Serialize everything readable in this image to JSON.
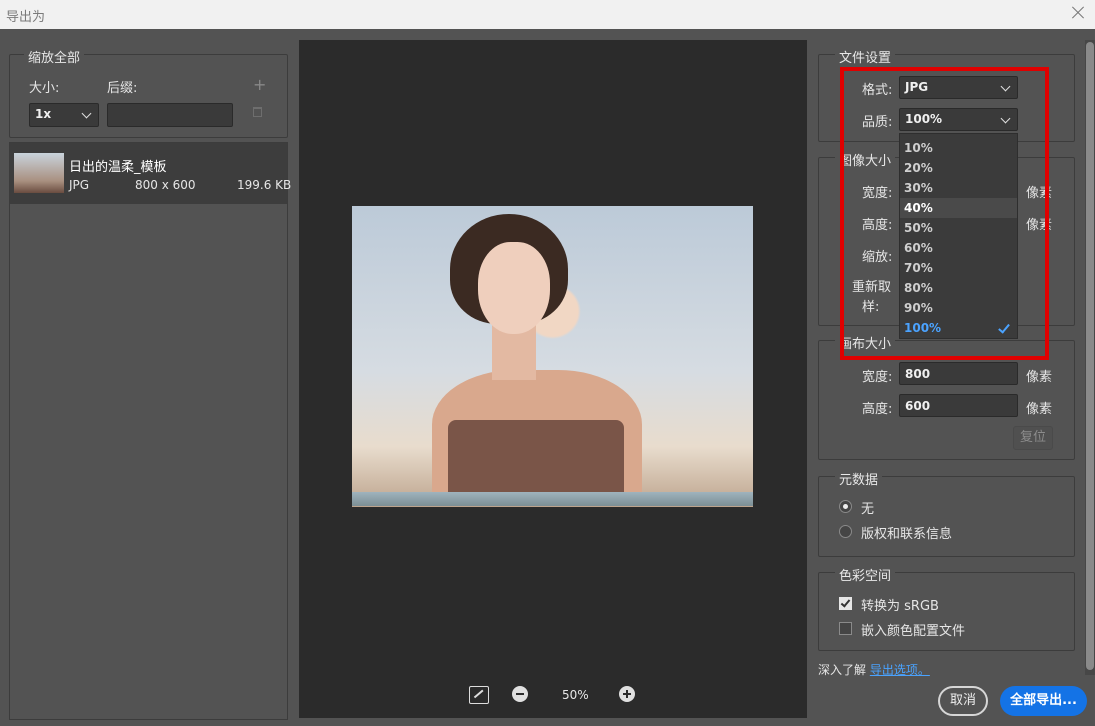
{
  "window": {
    "title": "导出为"
  },
  "left": {
    "scale_group_title": "缩放全部",
    "size_label": "大小:",
    "suffix_label": "后缀:",
    "size_value": "1x",
    "suffix_value": "",
    "add_icon": "plus-icon",
    "delete_icon": "trash-icon",
    "asset": {
      "name": "日出的温柔_模板",
      "format": "JPG",
      "dimensions": "800 x 600",
      "size": "199.6 KB"
    }
  },
  "preview": {
    "zoom": "50%"
  },
  "file_settings": {
    "title": "文件设置",
    "format_label": "格式:",
    "format_value": "JPG",
    "quality_label": "品质:",
    "quality_value": "100%",
    "quality_options": [
      "10%",
      "20%",
      "30%",
      "40%",
      "50%",
      "60%",
      "70%",
      "80%",
      "90%",
      "100%"
    ],
    "quality_hover_index": 3,
    "quality_selected_index": 9
  },
  "image_size": {
    "title": "图像大小",
    "width_label": "宽度:",
    "height_label": "高度:",
    "scale_label": "缩放:",
    "resample_label_1": "重新取",
    "resample_label_2": "样:",
    "width_unit": "像素",
    "height_unit": "像素"
  },
  "canvas_size": {
    "title": "画布大小",
    "width_label": "宽度:",
    "width_value": "800",
    "width_unit": "像素",
    "height_label": "高度:",
    "height_value": "600",
    "height_unit": "像素",
    "reset_label": "复位"
  },
  "metadata": {
    "title": "元数据",
    "option_none": "无",
    "option_copyright": "版权和联系信息"
  },
  "color_space": {
    "title": "色彩空间",
    "convert_srgb": "转换为 sRGB",
    "embed_profile": "嵌入颜色配置文件"
  },
  "footer": {
    "learn_prefix": "深入了解",
    "learn_link": "导出选项。",
    "cancel": "取消",
    "export_all": "全部导出..."
  },
  "annotation": {
    "color": "#e00000"
  }
}
